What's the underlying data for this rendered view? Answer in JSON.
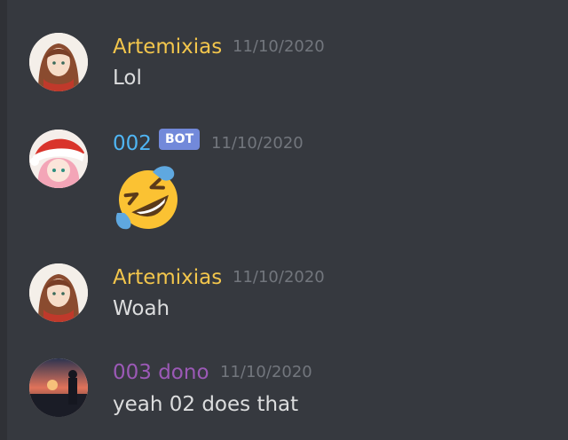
{
  "theme": {
    "background": "#36393f",
    "timestamp_color": "#72767d",
    "text_color": "#dcddde"
  },
  "messages": [
    {
      "author": "Artemixias",
      "author_color": "#f3c64c",
      "timestamp": "11/10/2020",
      "content": "Lol",
      "avatar_icon": "anime-girl-brown-hair-avatar"
    },
    {
      "author": "002",
      "author_color": "#4fb5f3",
      "tag": "BOT",
      "tag_color": "#7289da",
      "timestamp": "11/10/2020",
      "content_emoji": "rolling-on-the-floor-laughing",
      "avatar_icon": "anime-girl-santa-hat-avatar"
    },
    {
      "author": "Artemixias",
      "author_color": "#f3c64c",
      "timestamp": "11/10/2020",
      "content": "Woah",
      "avatar_icon": "anime-girl-brown-hair-avatar"
    },
    {
      "author": "003 dono",
      "author_color": "#9b59b6",
      "timestamp": "11/10/2020",
      "content": "yeah 02 does that",
      "avatar_icon": "sunset-scene-avatar"
    }
  ]
}
